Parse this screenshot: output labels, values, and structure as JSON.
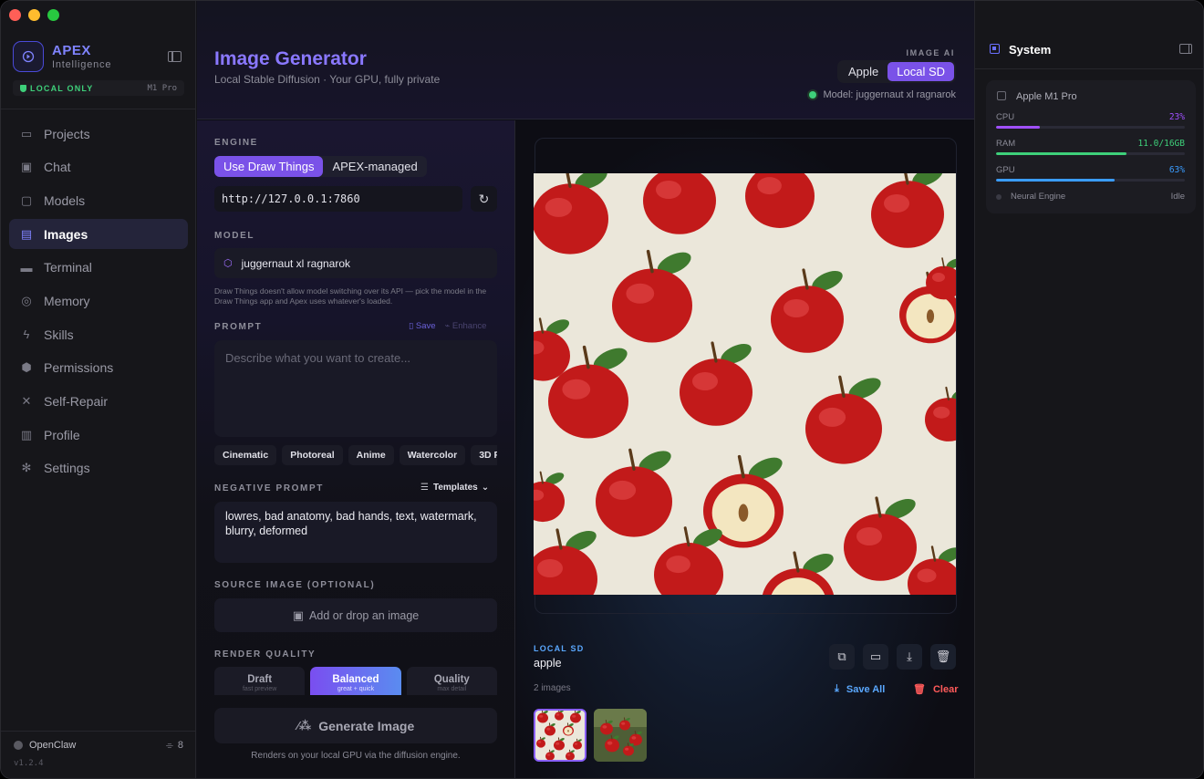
{
  "window": {
    "traffic_colors": [
      "#ff5f57",
      "#febc2e",
      "#28c840"
    ]
  },
  "brand": {
    "name": "APEX",
    "subtitle": "Intelligence",
    "mode_label": "LOCAL ONLY",
    "chip": "M1 Pro"
  },
  "sidebar": {
    "items": [
      {
        "label": "Projects",
        "icon": "folder-icon",
        "glyph": "▭",
        "active": false
      },
      {
        "label": "Chat",
        "icon": "chat-icon",
        "glyph": "▣",
        "active": false
      },
      {
        "label": "Models",
        "icon": "cpu-icon",
        "glyph": "▢",
        "active": false
      },
      {
        "label": "Images",
        "icon": "images-icon",
        "glyph": "▤",
        "active": true
      },
      {
        "label": "Terminal",
        "icon": "terminal-icon",
        "glyph": "▬",
        "active": false
      },
      {
        "label": "Memory",
        "icon": "memory-icon",
        "glyph": "◎",
        "active": false
      },
      {
        "label": "Skills",
        "icon": "bolt-icon",
        "glyph": "ϟ",
        "active": false
      },
      {
        "label": "Permissions",
        "icon": "shield-icon",
        "glyph": "⬢",
        "active": false
      },
      {
        "label": "Self-Repair",
        "icon": "wrench-icon",
        "glyph": "✕",
        "active": false
      },
      {
        "label": "Profile",
        "icon": "id-card-icon",
        "glyph": "▥",
        "active": false
      },
      {
        "label": "Settings",
        "icon": "gear-icon",
        "glyph": "✻",
        "active": false
      }
    ],
    "footer": {
      "name": "OpenClaw",
      "count": "8",
      "version": "v1.2.4"
    }
  },
  "header": {
    "title": "Image Generator",
    "subtitle": "Local Stable Diffusion · Your GPU, fully private",
    "image_ai_label": "IMAGE AI",
    "toggle": [
      "Apple",
      "Local SD"
    ],
    "toggle_selected": "Local SD",
    "model_status": "Model: juggernaut xl ragnarok"
  },
  "controls": {
    "engine_label": "ENGINE",
    "engine_options": [
      "Use Draw Things",
      "APEX-managed"
    ],
    "engine_selected": "Use Draw Things",
    "url": "http://127.0.0.1:7860",
    "model_label": "MODEL",
    "model_value": "juggernaut xl ragnarok",
    "model_note": "Draw Things doesn't allow model switching over its API — pick the model in the Draw Things app and Apex uses whatever's loaded.",
    "prompt_label": "PROMPT",
    "prompt_save": "Save",
    "prompt_enhance": "Enhance",
    "prompt_placeholder": "Describe what you want to create...",
    "styles": [
      "Cinematic",
      "Photoreal",
      "Anime",
      "Watercolor",
      "3D R"
    ],
    "negative_label": "NEGATIVE PROMPT",
    "templates_label": "Templates",
    "negative_value": "lowres, bad anatomy, bad hands, text, watermark, blurry, deformed",
    "source_label": "SOURCE IMAGE (OPTIONAL)",
    "source_drop": "Add or drop an image",
    "quality_label": "RENDER QUALITY",
    "quality_options": [
      {
        "title": "Draft",
        "sub": "fast preview"
      },
      {
        "title": "Balanced",
        "sub": "great + quick"
      },
      {
        "title": "Quality",
        "sub": "max detail"
      }
    ],
    "quality_selected": "Balanced",
    "generate_label": "Generate Image",
    "generate_note": "Renders on your local GPU via the diffusion engine."
  },
  "preview": {
    "engine_tag": "LOCAL SD",
    "prompt": "apple",
    "count": "2 images",
    "save_all": "Save All",
    "clear": "Clear",
    "actions": [
      "copy-icon",
      "folder-icon",
      "download-icon",
      "trash-icon"
    ]
  },
  "system": {
    "title": "System",
    "chip_name": "Apple M1 Pro",
    "metrics": [
      {
        "label": "CPU",
        "value": "23%",
        "fraction": 0.23,
        "color": "#a050ff"
      },
      {
        "label": "RAM",
        "value": "11.0/16GB",
        "fraction": 0.69,
        "color": "#3ed07a"
      },
      {
        "label": "GPU",
        "value": "63%",
        "fraction": 0.63,
        "color": "#3a9cff"
      }
    ],
    "neural_label": "Neural Engine",
    "neural_value": "Idle"
  }
}
